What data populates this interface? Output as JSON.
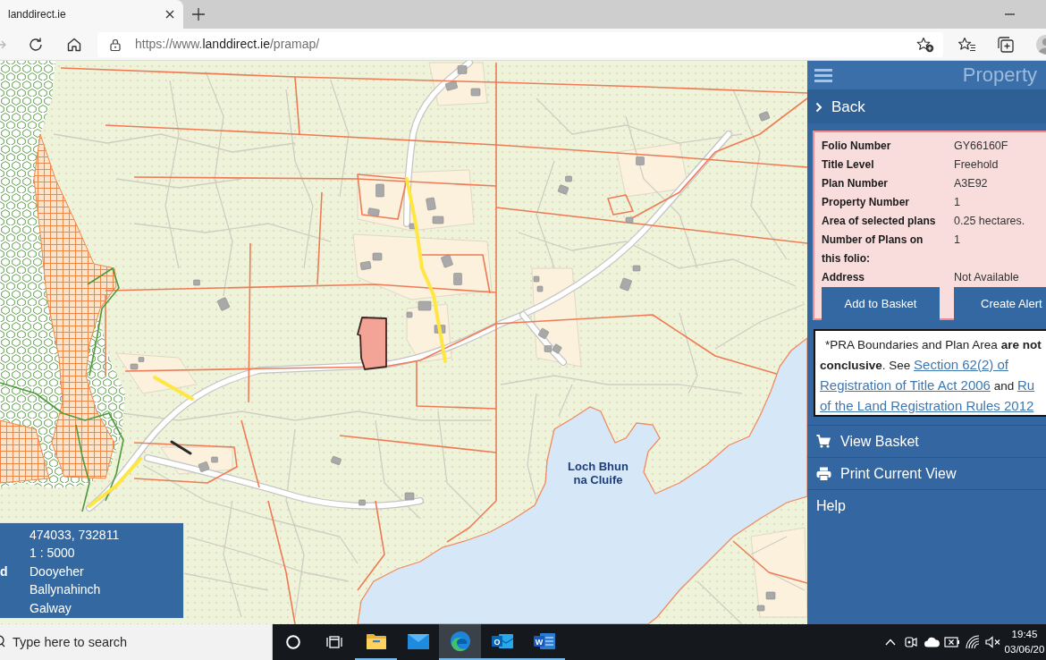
{
  "browser": {
    "tab": {
      "title": "landdirect.ie"
    },
    "forward_disabled": true,
    "address": {
      "scheme": "https://www.",
      "domain": "landdirect.ie",
      "path": "/pramap/"
    }
  },
  "map": {
    "lake_label": "Loch Bhun na Cluife",
    "info_box": {
      "rows": [
        {
          "value": "474033, 732811"
        },
        {
          "value": "1 : 5000"
        },
        {
          "label": "d",
          "value": "Dooyeher"
        },
        {
          "value": "Ballynahinch"
        },
        {
          "value": "Galway"
        }
      ]
    }
  },
  "panel": {
    "title": "Property",
    "back": "Back",
    "details": [
      {
        "label": "Folio Number",
        "value": "GY66160F"
      },
      {
        "label": "Title Level",
        "value": "Freehold"
      },
      {
        "label": "Plan Number",
        "value": "A3E92"
      },
      {
        "label": "Property Number",
        "value": "1"
      },
      {
        "label": "Area of selected plans",
        "value": "0.25 hectares."
      },
      {
        "label": "Number of Plans on this folio:",
        "value": "1"
      },
      {
        "label": "Address",
        "value": "Not Available"
      }
    ],
    "buttons": [
      "Add to Basket",
      "Create Alert"
    ],
    "notice": {
      "parts": [
        {
          "kind": "text",
          "text": "*PRA Boundaries and Plan Area **are not conclusive**. See"
        },
        {
          "kind": "link",
          "text": "Section 62(2) of"
        },
        {
          "kind": "link",
          "text": "Registration of Title Act 2006"
        },
        {
          "kind": "text",
          "text": "and"
        },
        {
          "kind": "link",
          "text": "Ru"
        },
        {
          "kind": "link",
          "text": "of the Land Registration Rules 2012"
        }
      ]
    },
    "menu": [
      {
        "kind": "cart",
        "label": "View Basket"
      },
      {
        "kind": "printer",
        "label": "Print Current View"
      },
      {
        "kind": "plain",
        "label": "Help"
      }
    ]
  },
  "taskbar": {
    "search": {
      "placeholder": "Type here to search"
    },
    "apps": [
      {
        "kind": "folder",
        "running": true,
        "selected": false
      },
      {
        "kind": "envelope",
        "running": false,
        "selected": false
      },
      {
        "kind": "browser",
        "running": true,
        "selected": true
      },
      {
        "kind": "mail-tile",
        "letter": "O",
        "running": true,
        "selected": false
      },
      {
        "kind": "document-tile",
        "letter": "W",
        "running": true,
        "selected": false
      }
    ],
    "volume_muted": true,
    "clock": {
      "time": "19:45",
      "date": "03/06/20"
    }
  }
}
